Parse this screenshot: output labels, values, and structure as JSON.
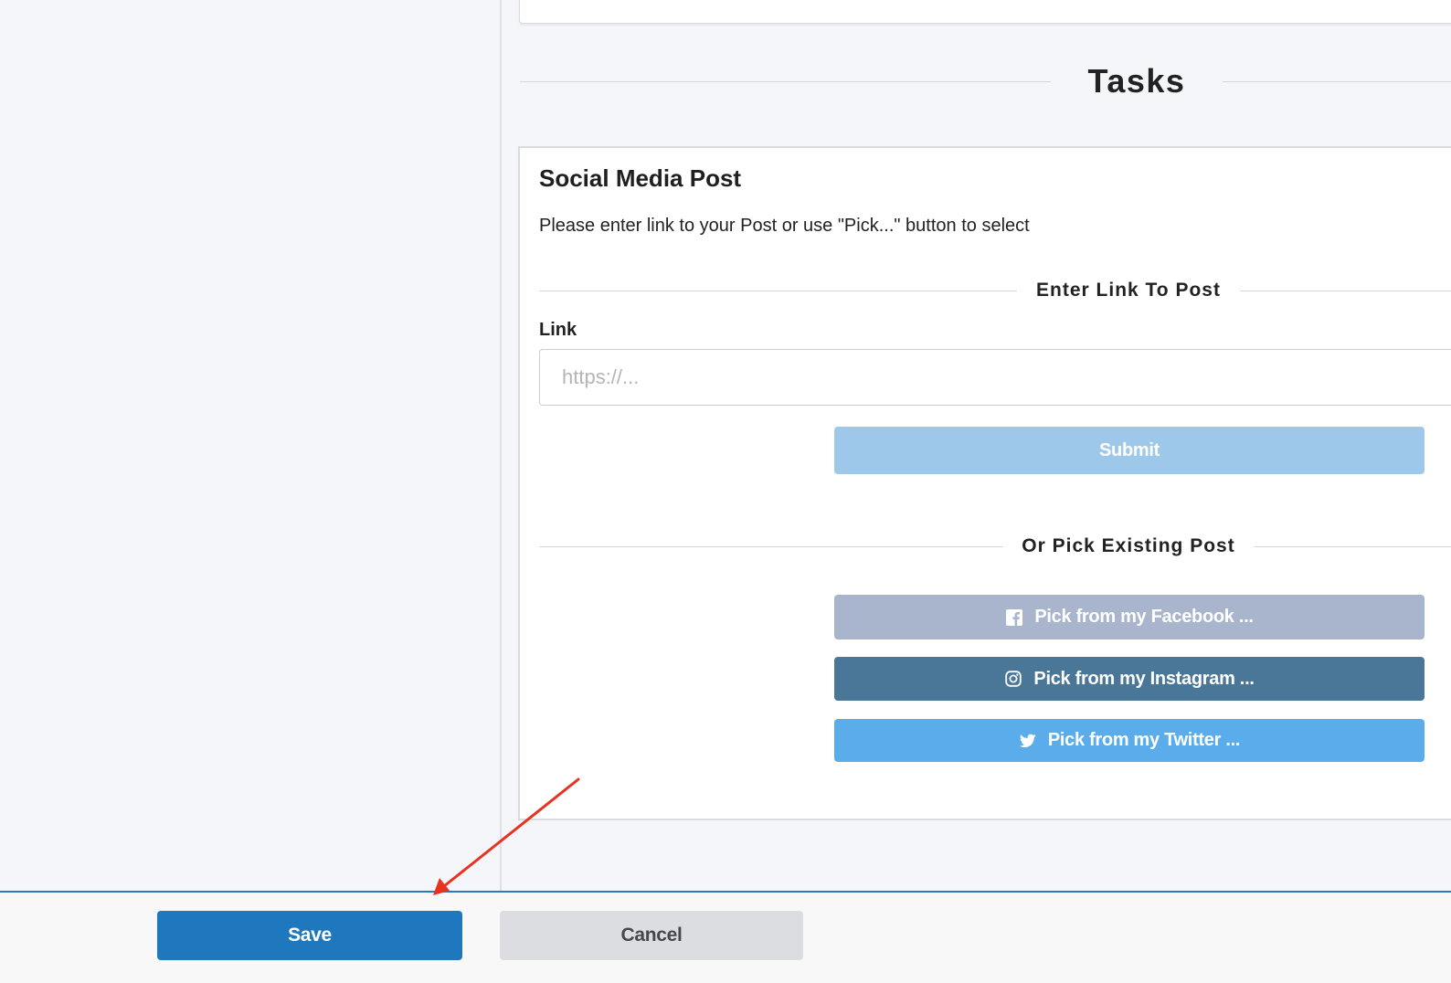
{
  "tasks_section": {
    "title": "Tasks"
  },
  "task_card": {
    "heading": "Social Media Post",
    "description": "Please enter link to your Post or use \"Pick...\" button to select",
    "enter_link_section": {
      "title": "Enter Link To Post"
    },
    "link_field": {
      "label": "Link",
      "placeholder": "https://...",
      "value": ""
    },
    "submit_button": {
      "label": "Submit"
    },
    "pick_section": {
      "title": "Or Pick Existing Post"
    },
    "pick_buttons": [
      {
        "label": "Pick from my Facebook ...",
        "icon": "facebook-icon",
        "color": "#a9b5cd"
      },
      {
        "label": "Pick from my Instagram ...",
        "icon": "instagram-icon",
        "color": "#4a7698"
      },
      {
        "label": "Pick from my Twitter ...",
        "icon": "twitter-icon",
        "color": "#5aadea"
      }
    ]
  },
  "footer": {
    "save_label": "Save",
    "cancel_label": "Cancel"
  },
  "colors": {
    "primary": "#1f77bd",
    "submit_disabled": "#9ec8e9",
    "page_background": "#f5f6f9",
    "annotation_arrow": "#e8321f"
  }
}
